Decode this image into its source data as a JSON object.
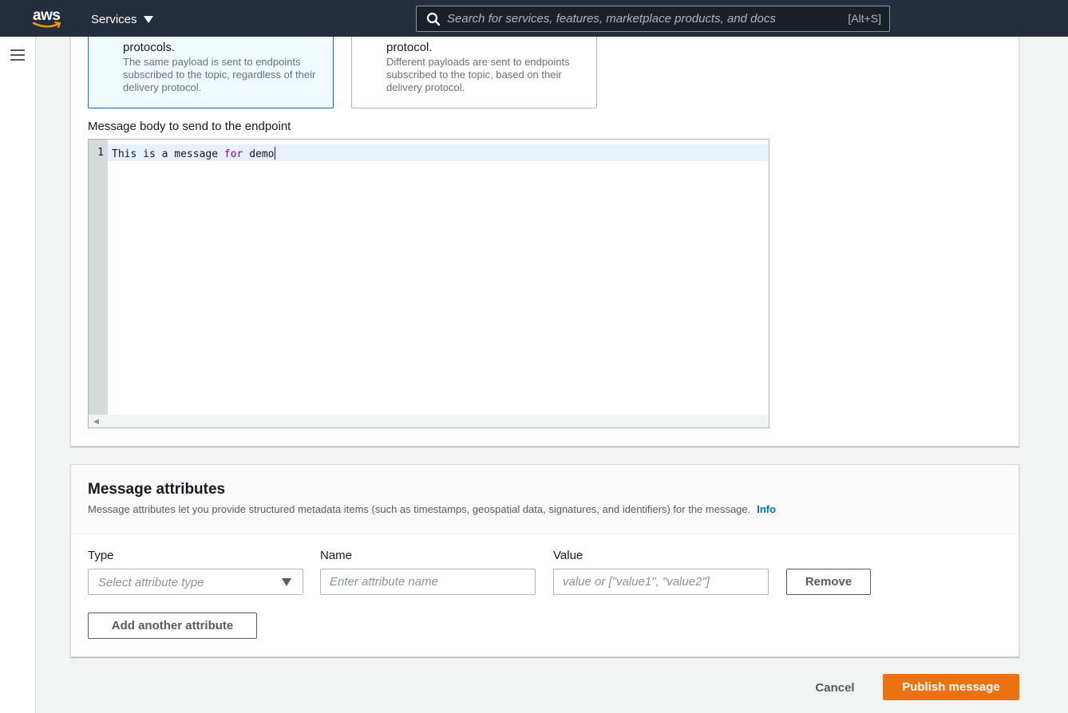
{
  "nav": {
    "logo_text": "aws",
    "services_label": "Services",
    "search_placeholder": "Search for services, features, marketplace products, and docs",
    "search_shortcut": "[Alt+S]"
  },
  "structure_options": [
    {
      "title": "protocols.",
      "description": "The same payload is sent to endpoints subscribed to the topic, regardless of their delivery protocol.",
      "selected": true
    },
    {
      "title": "protocol.",
      "description": "Different payloads are sent to endpoints subscribed to the topic, based on their delivery protocol.",
      "selected": false
    }
  ],
  "message_body": {
    "label": "Message body to send to the endpoint",
    "line_number": "1",
    "code_before": "This is a message ",
    "code_keyword": "for",
    "code_after": " demo"
  },
  "attributes": {
    "title": "Message attributes",
    "description": "Message attributes let you provide structured metadata items (such as timestamps, geospatial data, signatures, and identifiers) for the message.",
    "info_link": "Info",
    "type_label": "Type",
    "type_placeholder": "Select attribute type",
    "name_label": "Name",
    "name_placeholder": "Enter attribute name",
    "value_label": "Value",
    "value_placeholder": "value or [\"value1\", \"value2\"]",
    "remove_label": "Remove",
    "add_label": "Add another attribute"
  },
  "footer": {
    "cancel_label": "Cancel",
    "publish_label": "Publish message"
  },
  "colors": {
    "nav_bg": "#232f3e",
    "accent": "#ec7211",
    "link": "#0073bb",
    "selected_border": "#0073bb"
  }
}
